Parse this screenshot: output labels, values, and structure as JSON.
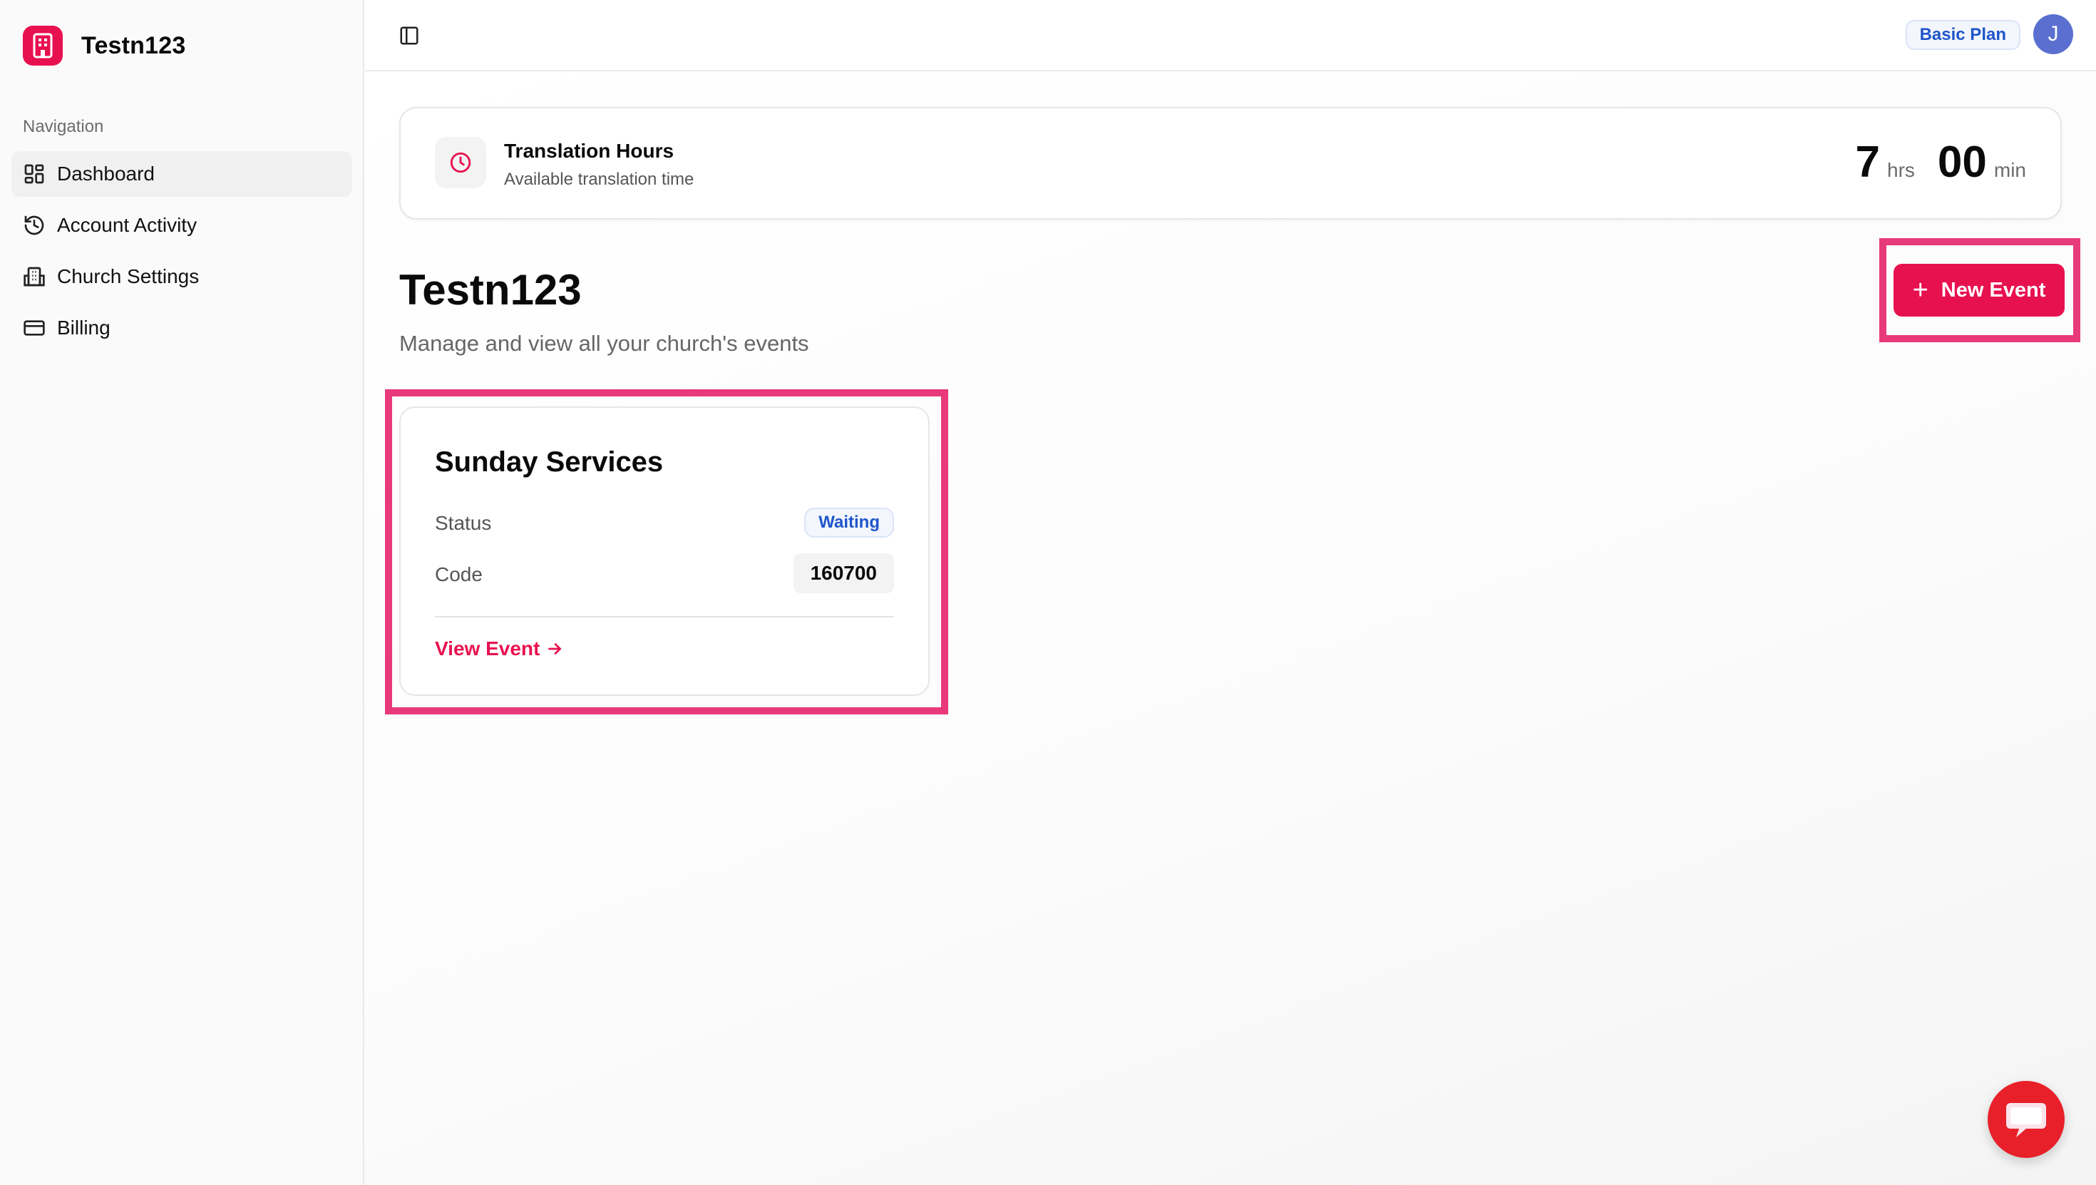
{
  "brand": {
    "name": "Testn123",
    "logo_icon": "building-icon",
    "accent": "#e8114f"
  },
  "sidebar": {
    "heading": "Navigation",
    "items": [
      {
        "label": "Dashboard",
        "icon": "dashboard-grid-icon",
        "active": true
      },
      {
        "label": "Account Activity",
        "icon": "history-icon",
        "active": false
      },
      {
        "label": "Church Settings",
        "icon": "church-building-icon",
        "active": false
      },
      {
        "label": "Billing",
        "icon": "credit-card-icon",
        "active": false
      }
    ]
  },
  "topbar": {
    "toggle_icon": "sidebar-toggle-icon",
    "plan": "Basic Plan",
    "avatar_initial": "J"
  },
  "hours": {
    "title": "Translation Hours",
    "subtitle": "Available translation time",
    "hours": "7",
    "hours_unit": "hrs",
    "minutes": "00",
    "minutes_unit": "min"
  },
  "page": {
    "title": "Testn123",
    "subtitle": "Manage and view all your church's events",
    "new_event_label": "New Event"
  },
  "events": [
    {
      "title": "Sunday Services",
      "status_label": "Status",
      "status": "Waiting",
      "code_label": "Code",
      "code": "160700",
      "link": "View Event"
    }
  ],
  "colors": {
    "primary": "#e8114f",
    "highlight": "#e8397a",
    "badge_blue": "#1f55c9",
    "fab": "#e8202a"
  }
}
